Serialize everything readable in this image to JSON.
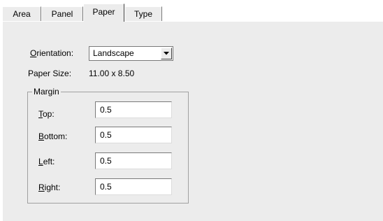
{
  "tabs": [
    {
      "label": "Area"
    },
    {
      "label": "Panel"
    },
    {
      "label": "Paper",
      "active": true
    },
    {
      "label": "Type"
    }
  ],
  "orientation": {
    "label_mnemonic": "O",
    "label_rest": "rientation:",
    "value": "Landscape",
    "icon": "dropdown-arrow-icon"
  },
  "paper_size": {
    "label": "Paper Size:",
    "value": "11.00 x 8.50"
  },
  "margin": {
    "title": "Margin",
    "top": {
      "mnemonic": "T",
      "rest": "op:",
      "value": "0.5"
    },
    "bottom": {
      "mnemonic": "B",
      "rest": "ottom:",
      "value": "0.5"
    },
    "left": {
      "mnemonic": "L",
      "rest": "eft:",
      "value": "0.5"
    },
    "right": {
      "mnemonic": "R",
      "rest": "ight:",
      "value": "0.5"
    }
  }
}
